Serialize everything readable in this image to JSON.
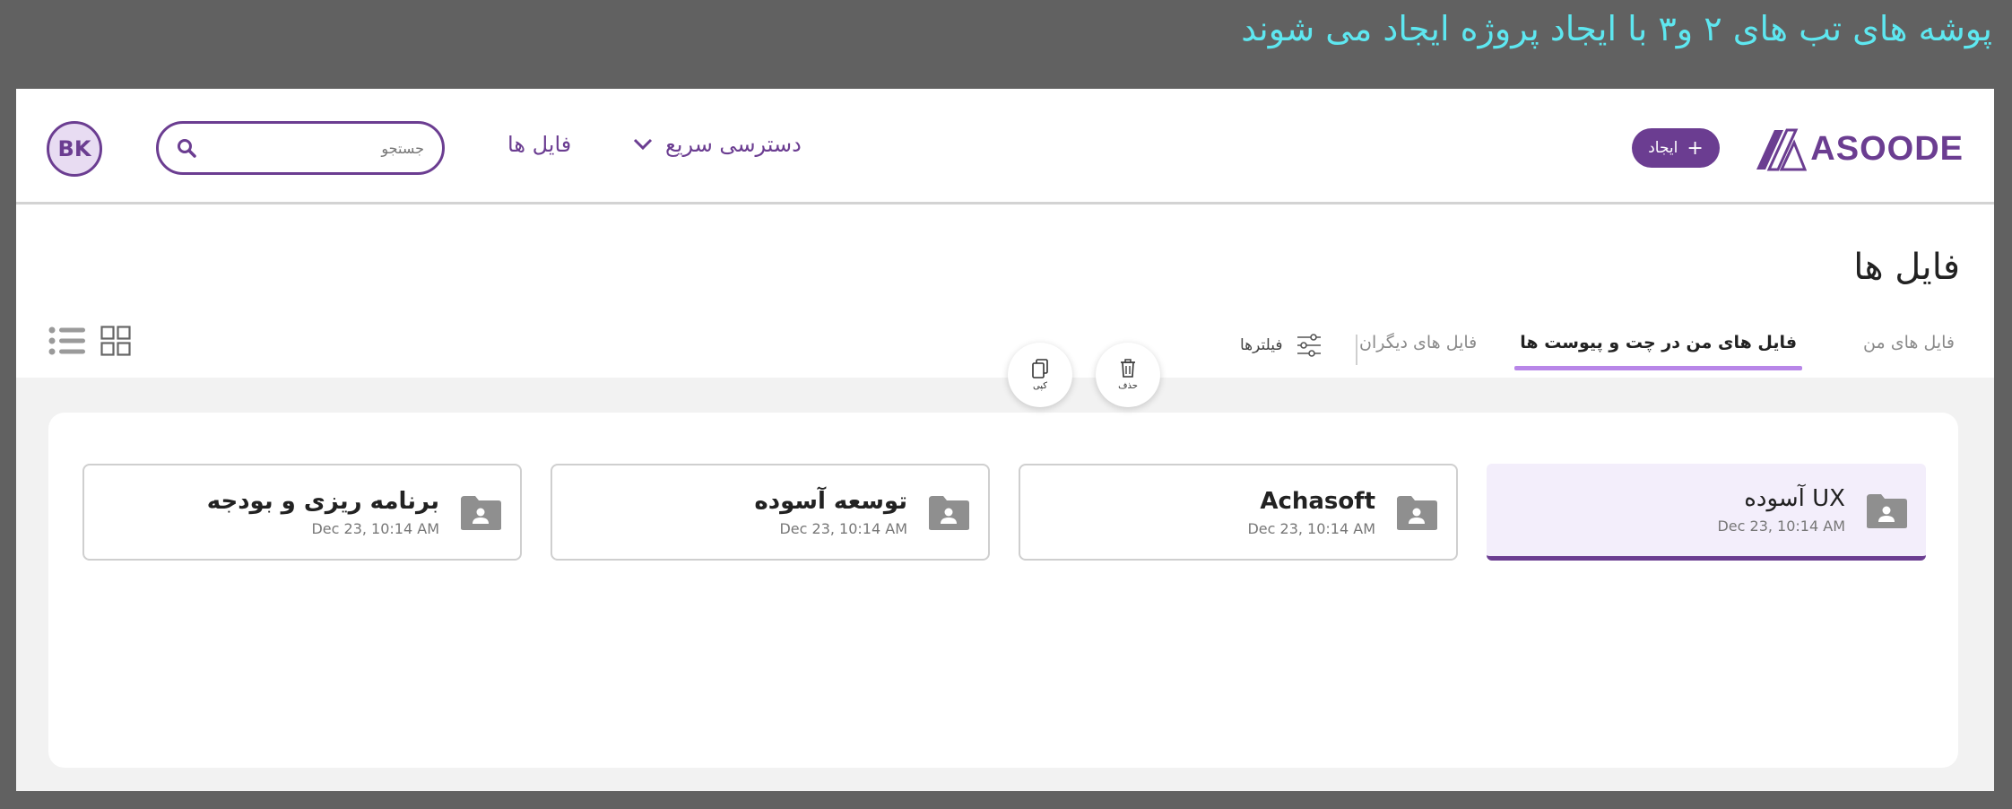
{
  "annotation": "پوشه های تب های ۲ و۳ با ایجاد پروژه  ایجاد می شوند",
  "header": {
    "logo_text": "ASOODE",
    "create_label": "ایجاد",
    "quick_access_label": "دسترسی سریع",
    "files_link": "فایل ها",
    "search_placeholder": "جستجو",
    "avatar_initials": "BK"
  },
  "page_title": "فایل ها",
  "tabs": [
    {
      "label": "فایل های من",
      "active": false
    },
    {
      "label": "فایل های من در چت و پیوست ها",
      "active": true
    },
    {
      "label": "فایل های دیگران",
      "active": false
    }
  ],
  "filters_label": "فیلترها",
  "actions": {
    "copy_label": "کپی",
    "delete_label": "حذف"
  },
  "folders": [
    {
      "name": "UX آسوده",
      "date": "Dec 23, 10:14 AM",
      "selected": true
    },
    {
      "name": "Achasoft",
      "date": "Dec 23, 10:14 AM",
      "selected": false
    },
    {
      "name": "توسعه آسوده",
      "date": "Dec 23, 10:14 AM",
      "selected": false
    },
    {
      "name": "برنامه ریزی و بودجه",
      "date": "Dec 23, 10:14 AM",
      "selected": false
    }
  ],
  "colors": {
    "brand": "#6b3d91",
    "tab_indicator": "#b886e8",
    "annotation": "#5ee7f0",
    "selected_folder_bg": "#f3eefb"
  },
  "icons": [
    "logo-mark-icon",
    "plus-icon",
    "chevron-down-icon",
    "search-icon",
    "filter-sliders-icon",
    "list-view-icon",
    "grid-view-icon",
    "copy-icon",
    "trash-icon",
    "shared-folder-icon"
  ]
}
